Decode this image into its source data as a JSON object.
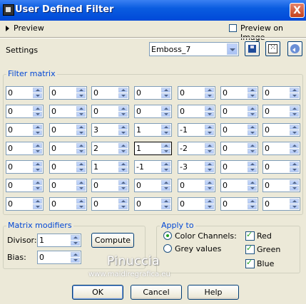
{
  "window": {
    "title": "User Defined Filter",
    "close_glyph": "X"
  },
  "preview": {
    "label": "Preview",
    "preview_on_image_label": "Preview on Image",
    "preview_on_image_checked": false
  },
  "settings": {
    "label": "Settings",
    "preset_value": "Emboss_7"
  },
  "icons": {
    "save": "save-disk-icon",
    "randomize": "dice-icon",
    "reset": "reset-arrow-icon"
  },
  "filter_matrix": {
    "label": "Filter matrix",
    "rows": [
      [
        "0",
        "0",
        "0",
        "0",
        "0",
        "0",
        "0"
      ],
      [
        "0",
        "0",
        "0",
        "0",
        "0",
        "0",
        "0"
      ],
      [
        "0",
        "0",
        "3",
        "1",
        "-1",
        "0",
        "0"
      ],
      [
        "0",
        "0",
        "2",
        "1",
        "-2",
        "0",
        "0"
      ],
      [
        "0",
        "0",
        "1",
        "-1",
        "-3",
        "0",
        "0"
      ],
      [
        "0",
        "0",
        "0",
        "0",
        "0",
        "0",
        "0"
      ],
      [
        "0",
        "0",
        "0",
        "0",
        "0",
        "0",
        "0"
      ]
    ]
  },
  "matrix_modifiers": {
    "label": "Matrix modifiers",
    "divisor_label": "Divisor:",
    "divisor_value": "1",
    "bias_label": "Bias:",
    "bias_value": "0",
    "compute_label": "Compute"
  },
  "apply_to": {
    "label": "Apply to",
    "color_channels_label": "Color Channels:",
    "grey_values_label": "Grey values",
    "selected": "color_channels",
    "red_label": "Red",
    "green_label": "Green",
    "blue_label": "Blue",
    "red_checked": true,
    "green_checked": true,
    "blue_checked": true
  },
  "watermark": {
    "name": "Pinuccia",
    "site": "www.maidiregrafica.eu"
  },
  "buttons": {
    "ok": "OK",
    "cancel": "Cancel",
    "help": "Help"
  },
  "colors": {
    "title_bar": "#0054e3",
    "group_label": "#0046d5",
    "dialog_bg": "#ece9d8"
  }
}
